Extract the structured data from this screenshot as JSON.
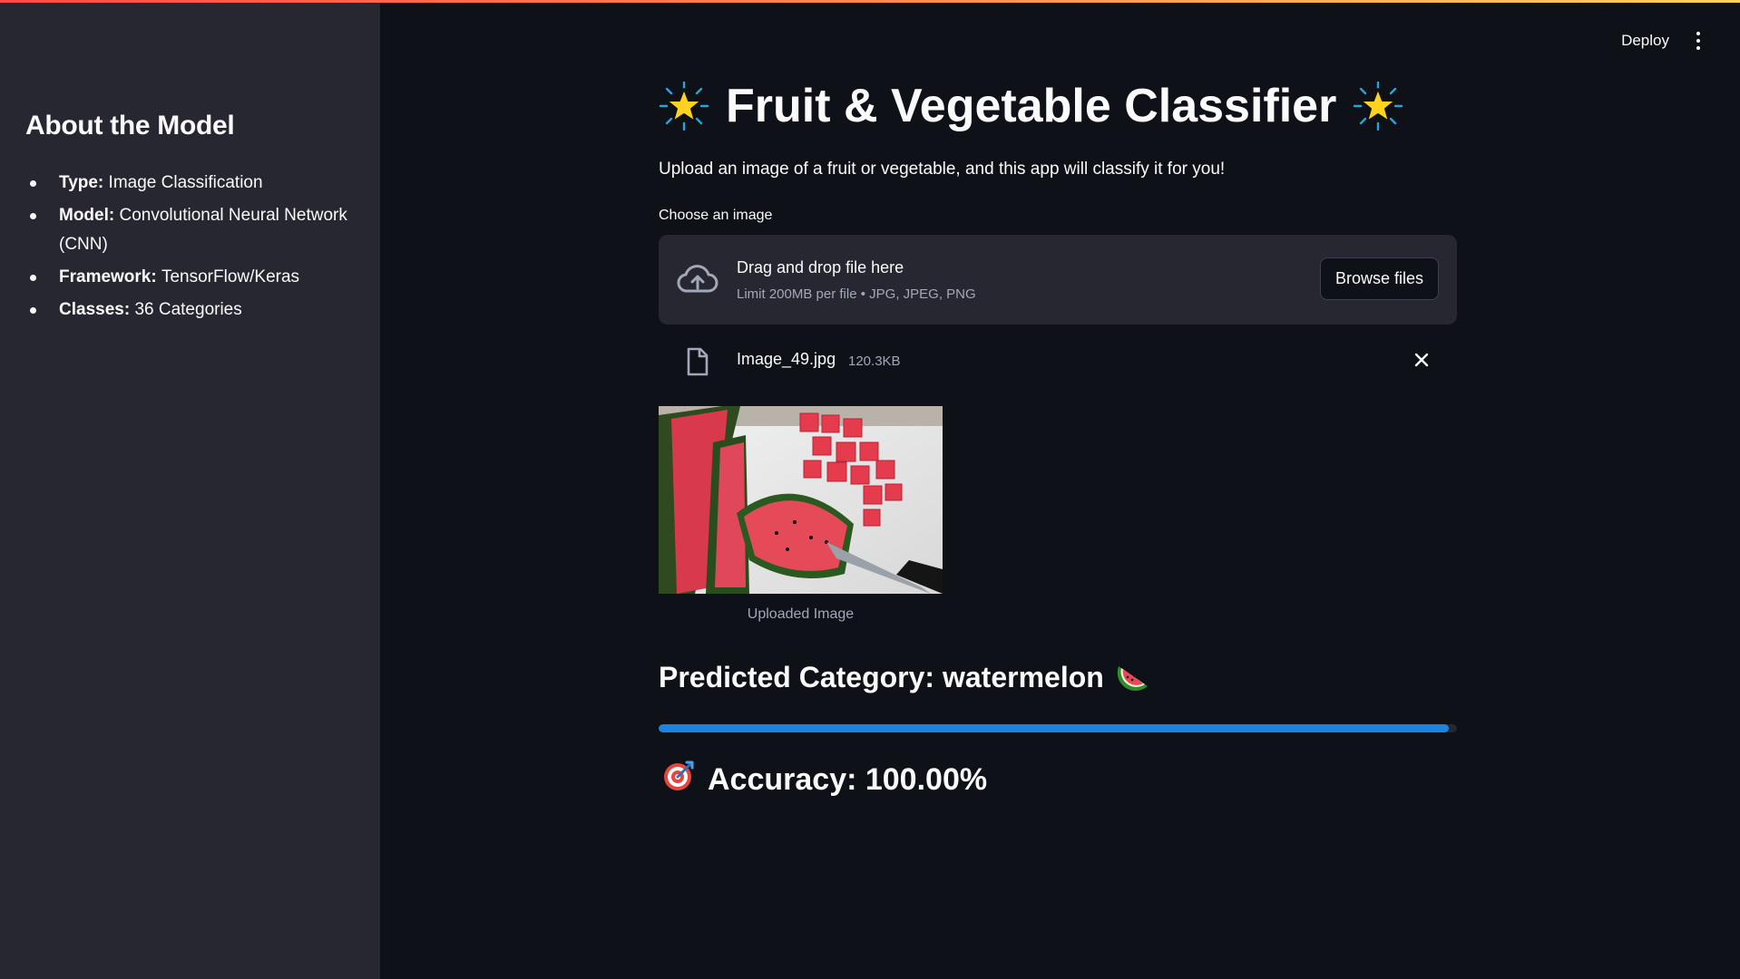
{
  "sidebar": {
    "heading": "About the Model",
    "items": [
      {
        "label": "Type:",
        "value": "Image Classification"
      },
      {
        "label": "Model:",
        "value": "Convolutional Neural Network (CNN)"
      },
      {
        "label": "Framework:",
        "value": "TensorFlow/Keras"
      },
      {
        "label": "Classes:",
        "value": "36 Categories"
      }
    ]
  },
  "header": {
    "deploy_label": "Deploy",
    "menu_icon": "kebab-menu-icon"
  },
  "main": {
    "title": "Fruit & Vegetable Classifier",
    "title_icon": "glowing-star-icon",
    "subtitle": "Upload an image of a fruit or vegetable, and this app will classify it for you!",
    "uploader": {
      "label": "Choose an image",
      "drop_title": "Drag and drop file here",
      "drop_sub": "Limit 200MB per file • JPG, JPEG, PNG",
      "browse_label": "Browse files",
      "icon": "cloud-upload-icon"
    },
    "file": {
      "name": "Image_49.jpg",
      "size": "120.3KB",
      "icon": "file-icon",
      "remove_icon": "close-icon"
    },
    "image_caption": "Uploaded Image",
    "prediction": {
      "text": "Predicted Category: watermelon",
      "icon": "watermelon-icon"
    },
    "progress": {
      "value": 0.99
    },
    "accuracy": {
      "text": "Accuracy: 100.00%",
      "icon": "target-icon"
    }
  },
  "colors": {
    "background": "#0e1117",
    "sidebar": "#262730",
    "progress": "#1c83e1",
    "text": "#fafafa",
    "muted": "#a3a8b8"
  }
}
